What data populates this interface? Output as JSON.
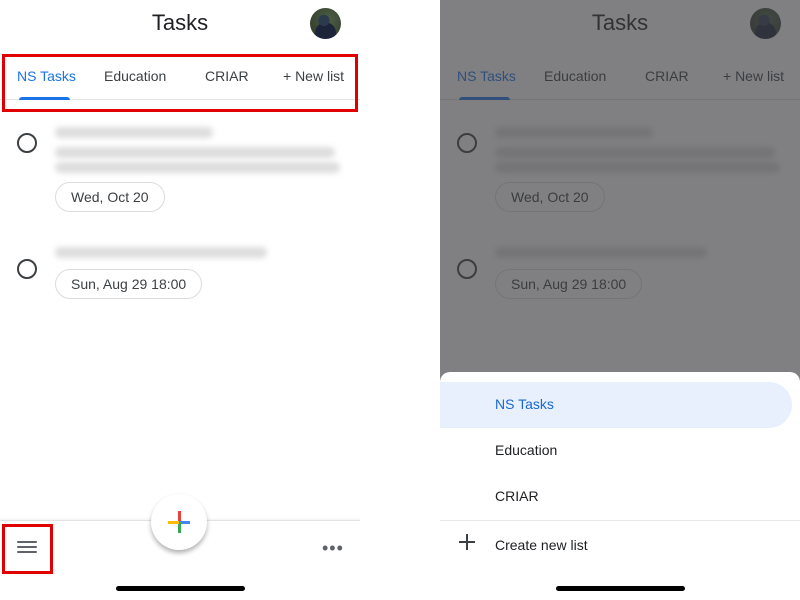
{
  "app": {
    "title": "Tasks"
  },
  "tabs": [
    {
      "label": "NS Tasks",
      "active": true
    },
    {
      "label": "Education",
      "active": false
    },
    {
      "label": "CRIAR",
      "active": false
    }
  ],
  "new_list_tab": "+ New list",
  "tasks": [
    {
      "title": "(blurred)",
      "date": "Wed, Oct 20"
    },
    {
      "title": "(blurred)",
      "date": "Sun, Aug 29 18:00"
    }
  ],
  "bottom_bar": {
    "menu_icon": "hamburger-menu-icon",
    "fab_icon": "multicolor-plus-icon",
    "more_label": "•••"
  },
  "list_sheet": {
    "items": [
      {
        "label": "NS Tasks",
        "active": true
      },
      {
        "label": "Education",
        "active": false
      },
      {
        "label": "CRIAR",
        "active": false
      }
    ],
    "create_label": "Create new list"
  },
  "colors": {
    "accent": "#1a73e8",
    "highlight": "#e00000",
    "selected_bg": "#e8f0fe"
  }
}
